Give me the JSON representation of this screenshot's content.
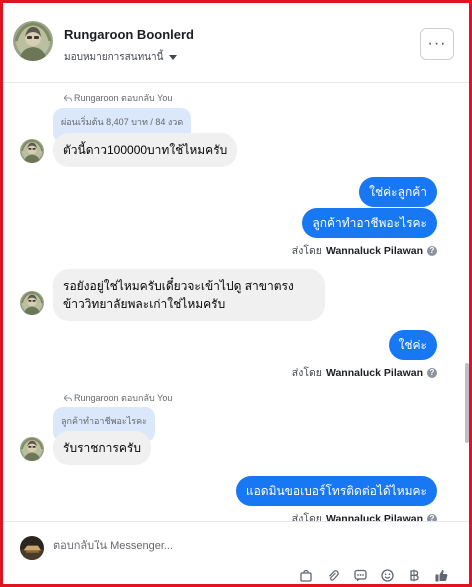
{
  "header": {
    "name": "Rungaroon Boonlerd",
    "assign_label": "มอบหมายการสนทนานี้",
    "more_label": "···"
  },
  "messages": {
    "reply1_label": "Rungaroon ตอบกลับ You",
    "reply1_quote": "ผ่อนเริ่มต้น 8,407 บาท / 84 งวด",
    "msg1": "ตัวนี้ดาว100000บาทใช้ไหมครับ",
    "out1": "ใช่ค่ะลูกค้า",
    "out2": "ลูกค้าทำอาชีพอะไรคะ",
    "msg2": "รอยังอยู่ใช่ไหมครับเดี๋ยวจะเข้าไปดู สาขาตรงข้าววิทยาลัยพละเก่าใช่ไหมครับ",
    "out3": "ใช่ค่ะ",
    "reply2_label": "Rungaroon ตอบกลับ You",
    "reply2_quote": "ลูกค้าทำอาชีพอะไรคะ",
    "msg3": "รับราชการครับ",
    "out4": "แอดมินขอเบอร์โทรติดต่อได้ไหมคะ"
  },
  "sent_by": {
    "prefix": "ส่งโดย",
    "sender": "Wannaluck Pilawan",
    "help_glyph": "?"
  },
  "composer": {
    "placeholder": "ตอบกลับใน Messenger..."
  },
  "icons": {
    "reply": "reply-arrow-icon",
    "more": "more-horizontal-icon",
    "caret": "caret-down-icon",
    "help": "question-icon",
    "bag": "shopping-bag-icon",
    "attach": "paperclip-icon",
    "saved": "saved-replies-icon",
    "emoji": "emoji-icon",
    "baht": "baht-icon",
    "like": "thumbs-up-icon"
  },
  "colors": {
    "accent_blue": "#1877f2",
    "incoming_bg": "#f0f0f0",
    "quote_bg": "#dbe7fb",
    "frame_red": "#e0141e"
  }
}
